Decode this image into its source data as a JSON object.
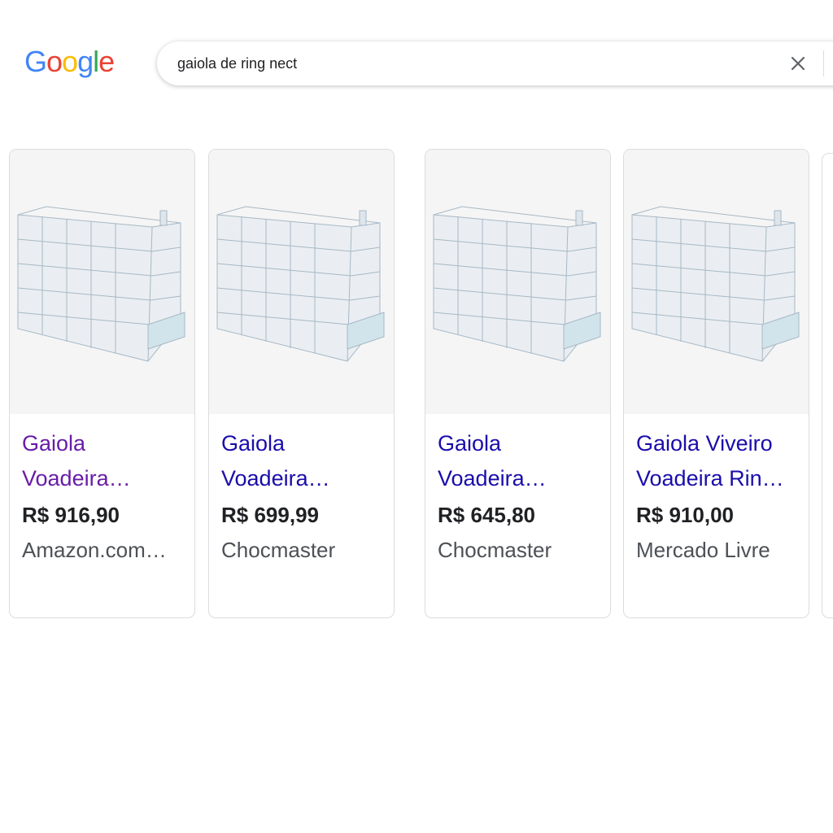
{
  "header": {
    "logo_letters": [
      {
        "char": "G",
        "color": "#4285F4"
      },
      {
        "char": "o",
        "color": "#EA4335"
      },
      {
        "char": "o",
        "color": "#FBBC05"
      },
      {
        "char": "g",
        "color": "#4285F4"
      },
      {
        "char": "l",
        "color": "#34A853"
      },
      {
        "char": "e",
        "color": "#EA4335"
      }
    ]
  },
  "search": {
    "query": "gaiola de ring nect",
    "clear_icon": "close-icon"
  },
  "colors": {
    "link": "#1a0dab",
    "visited_link": "#681da8",
    "price": "#202124",
    "seller": "#4d5156"
  },
  "products": [
    {
      "title_line1": "Gaiola",
      "title_line2": "Voadeira…",
      "price": "R$ 916,90",
      "seller": "Amazon.com…",
      "visited": true
    },
    {
      "title_line1": "Gaiola",
      "title_line2": "Voadeira…",
      "price": "R$ 699,99",
      "seller": "Chocmaster",
      "visited": false
    },
    {
      "title_line1": "Gaiola",
      "title_line2": "Voadeira…",
      "price": "R$ 645,80",
      "seller": "Chocmaster",
      "visited": false
    },
    {
      "title_line1": "Gaiola Viveiro",
      "title_line2": "Voadeira Rin…",
      "price": "R$ 910,00",
      "seller": "Mercado Livre",
      "visited": false
    }
  ]
}
